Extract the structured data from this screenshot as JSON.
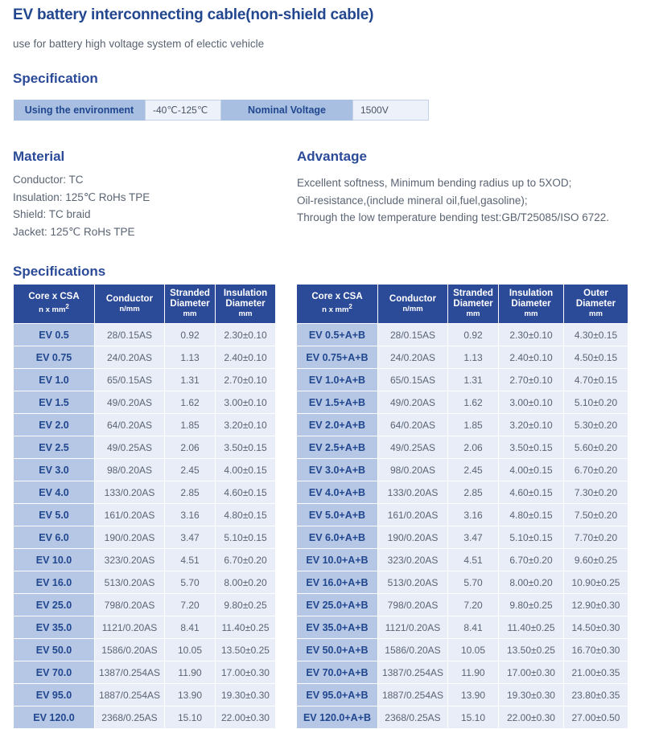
{
  "title": "EV battery interconnecting cable(non-shield cable)",
  "subtitle": "use for battery high voltage system of electic vehicle",
  "headings": {
    "specification": "Specification",
    "material": "Material",
    "advantage": "Advantage",
    "specifications": "Specifications"
  },
  "spec_bar": {
    "label_1": "Using the environment",
    "value_1": "-40℃-125℃",
    "label_2": "Nominal Voltage",
    "value_2": "1500V"
  },
  "material": {
    "lines": [
      "Conductor: TC",
      "Insulation: 125℃ RoHs TPE",
      "Shield: TC braid",
      "Jacket: 125℃ RoHs TPE"
    ]
  },
  "advantage": {
    "lines": [
      "Excellent softness, Minimum bending radius up to 5XOD;",
      "Oil-resistance,(include mineral oil,fuel,gasoline);",
      "Through the low temperature bending test:GB/T25085/ISO 6722."
    ]
  },
  "colors": {
    "brand_blue": "#2b4a98",
    "header_blue": "#2b4a98",
    "name_cell_blue": "#b5c7e5",
    "data_cell_blue": "#e8edf8",
    "spec_bar_blue": "#a8bfe2",
    "text_gray": "#5a6473"
  },
  "table_left": {
    "columns": [
      {
        "title": "Core x CSA",
        "unit": "n x mm",
        "sup": "2"
      },
      {
        "title": "Conductor",
        "unit": "n/mm",
        "sup": ""
      },
      {
        "title": "Stranded Diameter",
        "title_line1": "Stranded",
        "title_line2": "Diameter",
        "unit": "mm",
        "sup": ""
      },
      {
        "title": "Insulation Diameter",
        "title_line1": "Insulation",
        "title_line2": "Diameter",
        "unit": "mm",
        "sup": ""
      }
    ],
    "rows": [
      [
        "EV 0.5",
        "28/0.15AS",
        "0.92",
        "2.30±0.10"
      ],
      [
        "EV 0.75",
        "24/0.20AS",
        "1.13",
        "2.40±0.10"
      ],
      [
        "EV 1.0",
        "65/0.15AS",
        "1.31",
        "2.70±0.10"
      ],
      [
        "EV 1.5",
        "49/0.20AS",
        "1.62",
        "3.00±0.10"
      ],
      [
        "EV 2.0",
        "64/0.20AS",
        "1.85",
        "3.20±0.10"
      ],
      [
        "EV 2.5",
        "49/0.25AS",
        "2.06",
        "3.50±0.15"
      ],
      [
        "EV 3.0",
        "98/0.20AS",
        "2.45",
        "4.00±0.15"
      ],
      [
        "EV 4.0",
        "133/0.20AS",
        "2.85",
        "4.60±0.15"
      ],
      [
        "EV 5.0",
        "161/0.20AS",
        "3.16",
        "4.80±0.15"
      ],
      [
        "EV 6.0",
        "190/0.20AS",
        "3.47",
        "5.10±0.15"
      ],
      [
        "EV 10.0",
        "323/0.20AS",
        "4.51",
        "6.70±0.20"
      ],
      [
        "EV 16.0",
        "513/0.20AS",
        "5.70",
        "8.00±0.20"
      ],
      [
        "EV 25.0",
        "798/0.20AS",
        "7.20",
        "9.80±0.25"
      ],
      [
        "EV 35.0",
        "1121/0.20AS",
        "8.41",
        "11.40±0.25"
      ],
      [
        "EV 50.0",
        "1586/0.20AS",
        "10.05",
        "13.50±0.25"
      ],
      [
        "EV 70.0",
        "1387/0.254AS",
        "11.90",
        "17.00±0.30"
      ],
      [
        "EV 95.0",
        "1887/0.254AS",
        "13.90",
        "19.30±0.30"
      ],
      [
        "EV 120.0",
        "2368/0.25AS",
        "15.10",
        "22.00±0.30"
      ]
    ]
  },
  "table_right": {
    "columns": [
      {
        "title": "Core x CSA",
        "unit": "n x mm",
        "sup": "2"
      },
      {
        "title": "Conductor",
        "unit": "n/mm",
        "sup": ""
      },
      {
        "title": "Stranded Diameter",
        "title_line1": "Stranded",
        "title_line2": "Diameter",
        "unit": "mm",
        "sup": ""
      },
      {
        "title": "Insulation Diameter",
        "title_line1": "Insulation",
        "title_line2": "Diameter",
        "unit": "mm",
        "sup": ""
      },
      {
        "title": "Outer Diameter",
        "title_line1": "Outer",
        "title_line2": "Diameter",
        "unit": "mm",
        "sup": ""
      }
    ],
    "rows": [
      [
        "EV 0.5+A+B",
        "28/0.15AS",
        "0.92",
        "2.30±0.10",
        "4.30±0.15"
      ],
      [
        "EV 0.75+A+B",
        "24/0.20AS",
        "1.13",
        "2.40±0.10",
        "4.50±0.15"
      ],
      [
        "EV 1.0+A+B",
        "65/0.15AS",
        "1.31",
        "2.70±0.10",
        "4.70±0.15"
      ],
      [
        "EV 1.5+A+B",
        "49/0.20AS",
        "1.62",
        "3.00±0.10",
        "5.10±0.20"
      ],
      [
        "EV 2.0+A+B",
        "64/0.20AS",
        "1.85",
        "3.20±0.10",
        "5.30±0.20"
      ],
      [
        "EV 2.5+A+B",
        "49/0.25AS",
        "2.06",
        "3.50±0.15",
        "5.60±0.20"
      ],
      [
        "EV 3.0+A+B",
        "98/0.20AS",
        "2.45",
        "4.00±0.15",
        "6.70±0.20"
      ],
      [
        "EV 4.0+A+B",
        "133/0.20AS",
        "2.85",
        "4.60±0.15",
        "7.30±0.20"
      ],
      [
        "EV 5.0+A+B",
        "161/0.20AS",
        "3.16",
        "4.80±0.15",
        "7.50±0.20"
      ],
      [
        "EV 6.0+A+B",
        "190/0.20AS",
        "3.47",
        "5.10±0.15",
        "7.70±0.20"
      ],
      [
        "EV 10.0+A+B",
        "323/0.20AS",
        "4.51",
        "6.70±0.20",
        "9.60±0.25"
      ],
      [
        "EV 16.0+A+B",
        "513/0.20AS",
        "5.70",
        "8.00±0.20",
        "10.90±0.25"
      ],
      [
        "EV 25.0+A+B",
        "798/0.20AS",
        "7.20",
        "9.80±0.25",
        "12.90±0.30"
      ],
      [
        "EV 35.0+A+B",
        "1121/0.20AS",
        "8.41",
        "11.40±0.25",
        "14.50±0.30"
      ],
      [
        "EV 50.0+A+B",
        "1586/0.20AS",
        "10.05",
        "13.50±0.25",
        "16.70±0.30"
      ],
      [
        "EV 70.0+A+B",
        "1387/0.254AS",
        "11.90",
        "17.00±0.30",
        "21.00±0.35"
      ],
      [
        "EV 95.0+A+B",
        "1887/0.254AS",
        "13.90",
        "19.30±0.30",
        "23.80±0.35"
      ],
      [
        "EV 120.0+A+B",
        "2368/0.25AS",
        "15.10",
        "22.00±0.30",
        "27.00±0.50"
      ]
    ]
  }
}
